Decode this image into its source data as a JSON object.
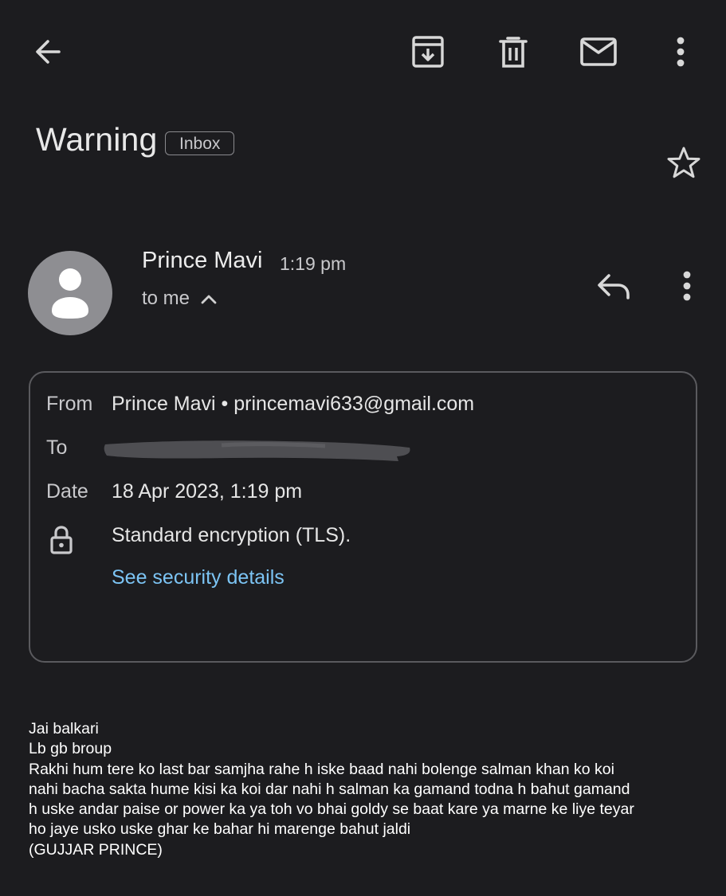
{
  "toolbar": {
    "back_icon": "arrow-left-icon",
    "archive_icon": "archive-icon",
    "delete_icon": "trash-icon",
    "mark_unread_icon": "mail-icon",
    "more_icon": "more-vertical-icon"
  },
  "email": {
    "subject": "Warning",
    "label": "Inbox",
    "starred": false
  },
  "sender": {
    "name": "Prince Mavi",
    "time": "1:19 pm",
    "recipient_summary": "to me"
  },
  "details": {
    "from_label": "From",
    "from_value": "Prince Mavi • princemavi633@gmail.com",
    "to_label": "To",
    "date_label": "Date",
    "date_value": "18 Apr 2023, 1:19 pm",
    "encryption_text": "Standard encryption (TLS).",
    "security_link": "See security details"
  },
  "body": {
    "lines": [
      "Jai balkari",
      "Lb gb broup",
      "Rakhi hum tere ko last bar samjha rahe h iske baad nahi bolenge salman khan ko koi",
      "nahi bacha sakta hume kisi ka koi dar nahi h salman ka gamand todna h bahut gamand",
      "h uske andar paise or power ka ya toh vo bhai goldy se baat kare ya marne ke liye teyar",
      "ho jaye usko uske ghar ke bahar hi marenge bahut jaldi",
      "(GUJJAR PRINCE)"
    ]
  },
  "colors": {
    "background": "#1c1c1f",
    "link": "#7cc4f4",
    "avatar": "#8e8e92"
  }
}
